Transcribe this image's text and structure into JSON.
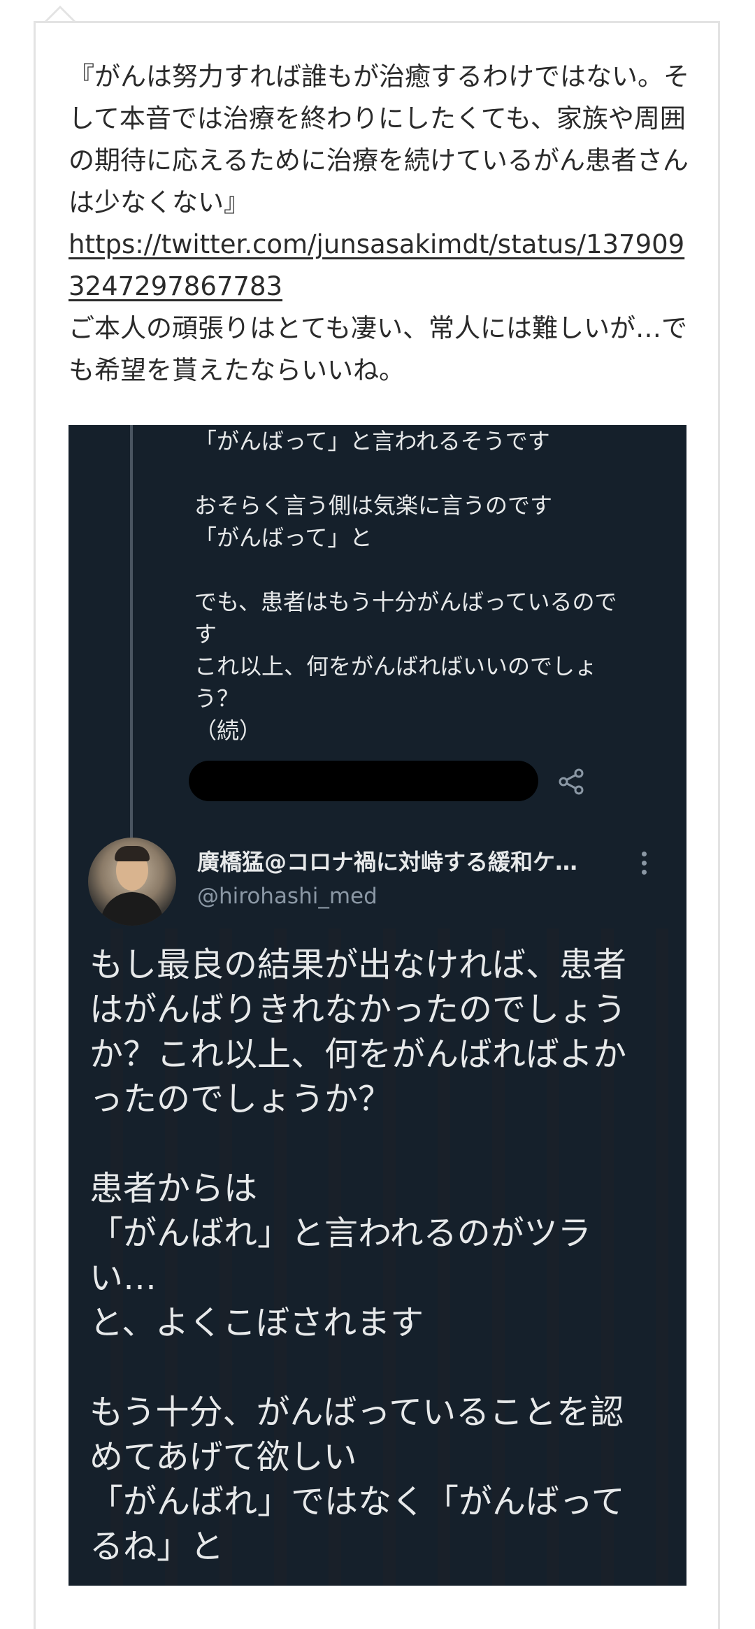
{
  "post": {
    "quote": "『がんは努力すれば誰もが治癒するわけではない。そして本音では治療を終わりにしたくても、家族や周囲の期待に応えるために治療を続けているがん患者さんは少なくない』",
    "link": "https://twitter.com/junsasakimdt/status/1379093247297867783",
    "comment": "ご本人の頑張りはとても凄い、常人には難しいが…でも希望を貰えたならいいね。"
  },
  "tweet_prev": {
    "lines": [
      "「がんばって」と言われるそうです",
      "",
      "おそらく言う側は気楽に言うのです",
      "「がんばって」と",
      "",
      "でも、患者はもう十分がんばっているので",
      "す",
      "これ以上、何をがんばればいいのでしょ",
      "う？",
      "（続）"
    ],
    "share_icon": "share-icon"
  },
  "tweet_main": {
    "author_name": "廣橋猛@コロナ禍に対峙する緩和ケ…",
    "author_handle": "@hirohashi_med",
    "lines": [
      "もし最良の結果が出なければ、患者",
      "はがんばりきれなかったのでしょう",
      "か？これ以上、何をがんばればよか",
      "ったのでしょうか？",
      "",
      "患者からは",
      "「がんばれ」と言われるのがツラ",
      "い…",
      "と、よくこぼされます",
      "",
      "もう十分、がんばっていることを認",
      "めてあげて欲しい",
      "「がんばれ」ではなく「がんばって",
      "るね」と"
    ],
    "more_icon": "more-vertical-icon"
  },
  "colors": {
    "tweet_bg": "#15202b",
    "tweet_text": "#e7e9ea",
    "handle_text": "#8b98a5",
    "post_text": "#2a2a2a"
  }
}
